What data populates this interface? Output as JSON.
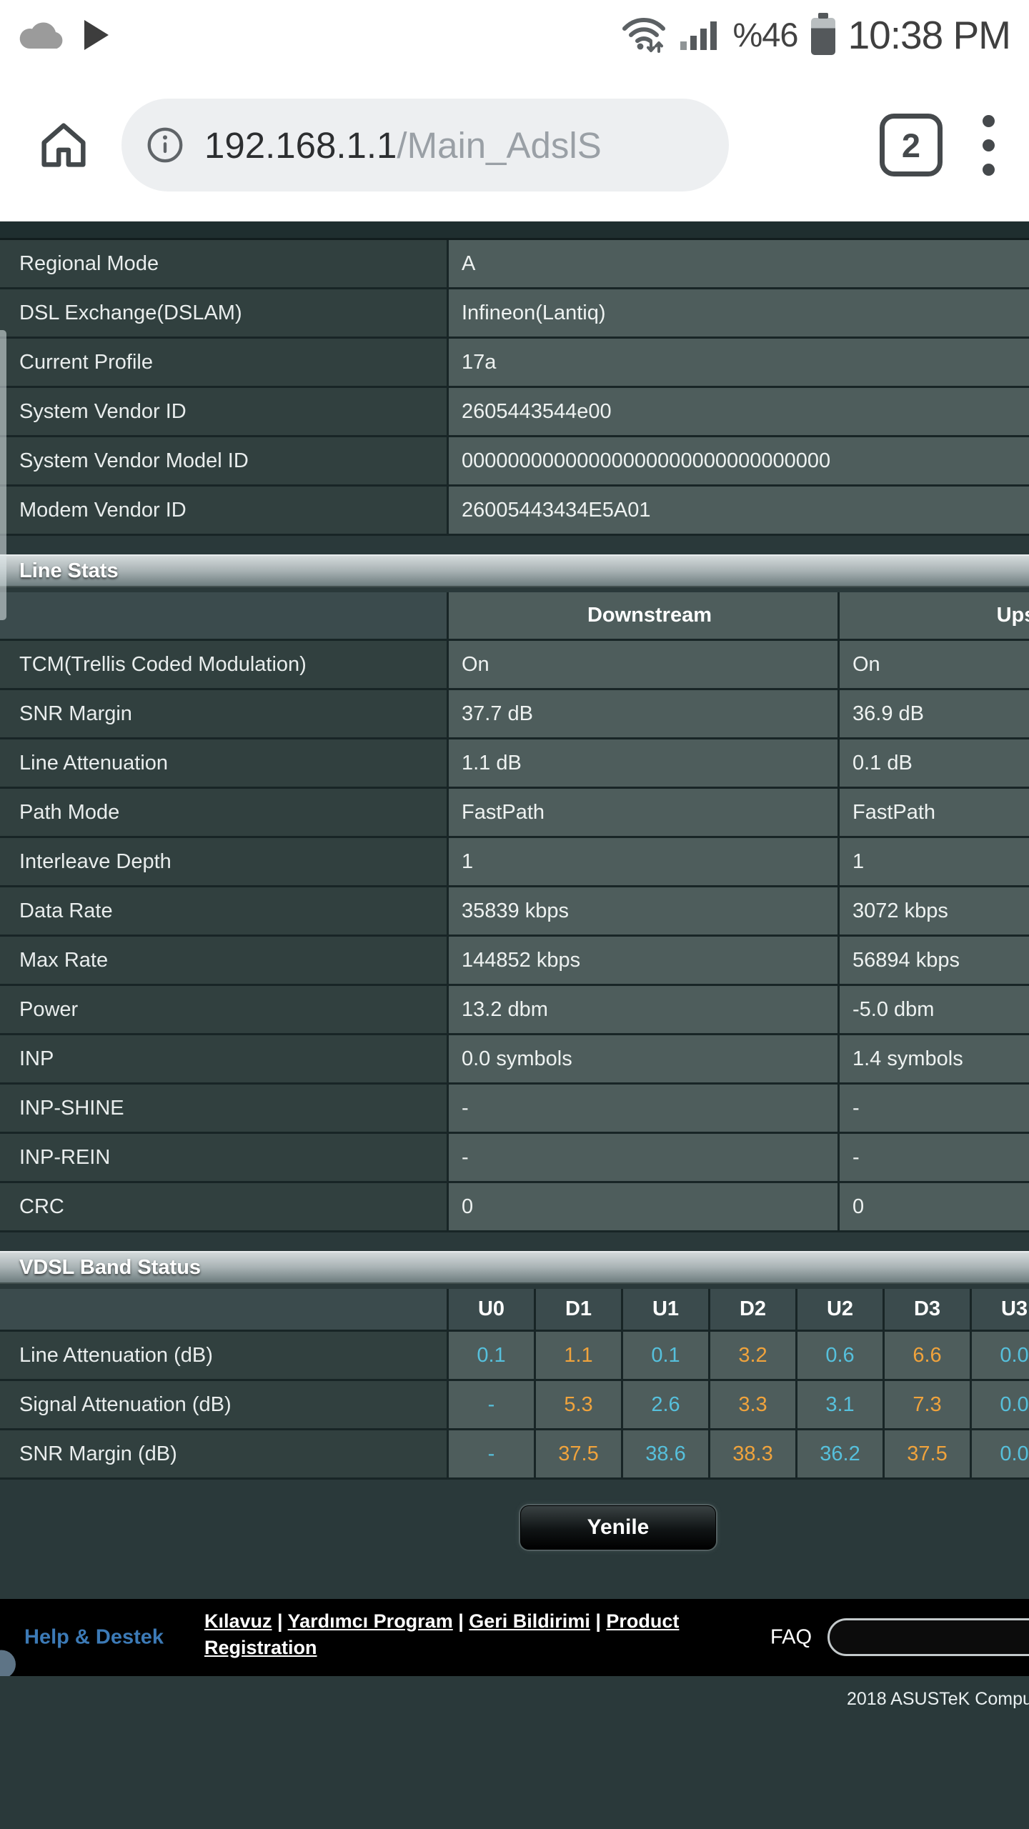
{
  "status_bar": {
    "time": "10:38 PM",
    "battery_pct": "%46"
  },
  "browser": {
    "url_host": "192.168.1.1",
    "url_path": "/Main_AdslS",
    "tab_count": "2"
  },
  "info_table": {
    "rows": [
      {
        "label": "Regional Mode",
        "value": "A"
      },
      {
        "label": "DSL Exchange(DSLAM)",
        "value": "Infineon(Lantiq)"
      },
      {
        "label": "Current Profile",
        "value": "17a"
      },
      {
        "label": "System Vendor ID",
        "value": "2605443544e00"
      },
      {
        "label": "System Vendor Model ID",
        "value": "00000000000000000000000000000000"
      },
      {
        "label": "Modem Vendor ID",
        "value": "26005443434E5A01"
      }
    ]
  },
  "line_stats": {
    "title": "Line Stats",
    "col_downstream": "Downstream",
    "col_upstream": "Upstream",
    "rows": [
      {
        "label": "TCM(Trellis Coded Modulation)",
        "down": "On",
        "up": "On"
      },
      {
        "label": "SNR Margin",
        "down": "37.7 dB",
        "up": "36.9 dB"
      },
      {
        "label": "Line Attenuation",
        "down": "1.1 dB",
        "up": "0.1 dB"
      },
      {
        "label": "Path Mode",
        "down": "FastPath",
        "up": "FastPath"
      },
      {
        "label": "Interleave Depth",
        "down": "1",
        "up": "1"
      },
      {
        "label": "Data Rate",
        "down": "35839 kbps",
        "up": "3072 kbps"
      },
      {
        "label": "Max Rate",
        "down": "144852 kbps",
        "up": "56894 kbps"
      },
      {
        "label": "Power",
        "down": "13.2 dbm",
        "up": "-5.0 dbm"
      },
      {
        "label": "INP",
        "down": "0.0 symbols",
        "up": "1.4 symbols"
      },
      {
        "label": "INP-SHINE",
        "down": "-",
        "up": "-"
      },
      {
        "label": "INP-REIN",
        "down": "-",
        "up": "-"
      },
      {
        "label": "CRC",
        "down": "0",
        "up": "0"
      }
    ]
  },
  "vdsl_band": {
    "title": "VDSL Band Status",
    "columns": [
      "U0",
      "D1",
      "U1",
      "D2",
      "U2",
      "D3",
      "U3"
    ],
    "rows": [
      {
        "label": "Line Attenuation (dB)",
        "values": [
          "0.1",
          "1.1",
          "0.1",
          "3.2",
          "0.6",
          "6.6",
          "0.0"
        ]
      },
      {
        "label": "Signal Attenuation (dB)",
        "values": [
          "-",
          "5.3",
          "2.6",
          "3.3",
          "3.1",
          "7.3",
          "0.0"
        ]
      },
      {
        "label": "SNR Margin (dB)",
        "values": [
          "-",
          "37.5",
          "38.6",
          "38.3",
          "36.2",
          "37.5",
          "0.0"
        ]
      }
    ],
    "colors": {
      "upstream": "#56c0dc",
      "downstream": "#f0a33c"
    }
  },
  "actions": {
    "refresh_label": "Yenile"
  },
  "footer": {
    "help_label": "Help & Destek",
    "help_color": "#3c7ab6",
    "links": [
      {
        "label": "Kılavuz",
        "sep": " | "
      },
      {
        "label": "Yardımcı Program",
        "sep": " | "
      },
      {
        "label": "Geri Bildirimi",
        "sep": " | "
      },
      {
        "label": "Product Registration",
        "sep": ""
      }
    ],
    "faq_label": "FAQ",
    "copyright": "2018 ASUSTeK Compu"
  }
}
